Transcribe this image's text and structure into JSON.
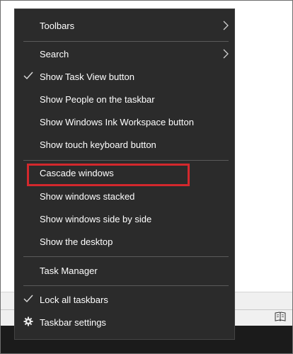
{
  "menu": {
    "items": [
      {
        "label": "Toolbars",
        "has_submenu": true,
        "checked": false
      },
      {
        "label": "Search",
        "has_submenu": true,
        "checked": false
      },
      {
        "label": "Show Task View button",
        "has_submenu": false,
        "checked": true
      },
      {
        "label": "Show People on the taskbar",
        "has_submenu": false,
        "checked": false
      },
      {
        "label": "Show Windows Ink Workspace button",
        "has_submenu": false,
        "checked": false
      },
      {
        "label": "Show touch keyboard button",
        "has_submenu": false,
        "checked": false
      },
      {
        "label": "Cascade windows",
        "has_submenu": false,
        "checked": false,
        "highlighted": true
      },
      {
        "label": "Show windows stacked",
        "has_submenu": false,
        "checked": false
      },
      {
        "label": "Show windows side by side",
        "has_submenu": false,
        "checked": false
      },
      {
        "label": "Show the desktop",
        "has_submenu": false,
        "checked": false
      },
      {
        "label": "Task Manager",
        "has_submenu": false,
        "checked": false
      },
      {
        "label": "Lock all taskbars",
        "has_submenu": false,
        "checked": true
      },
      {
        "label": "Taskbar settings",
        "has_submenu": false,
        "checked": false,
        "icon": "gear-icon"
      }
    ]
  },
  "colors": {
    "menu_background": "#2b2b2b",
    "menu_text": "#ffffff",
    "highlight_border": "#d3282d",
    "taskbar": "#1b1b1b"
  }
}
